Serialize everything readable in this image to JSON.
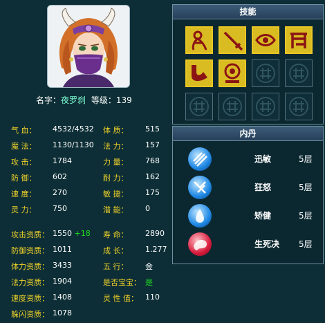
{
  "character": {
    "name_label": "名字：",
    "name": "夜罗刹",
    "level_label": "等级：",
    "level": "139"
  },
  "stats": [
    {
      "label": "气    血：",
      "value": "4532/4532"
    },
    {
      "label": "体    质：",
      "value": "515"
    },
    {
      "label": "魔    法：",
      "value": "1130/1130"
    },
    {
      "label": "法    力：",
      "value": "157"
    },
    {
      "label": "攻    击：",
      "value": "1784"
    },
    {
      "label": "力    量：",
      "value": "768"
    },
    {
      "label": "防    御：",
      "value": "602"
    },
    {
      "label": "耐    力：",
      "value": "162"
    },
    {
      "label": "速    度：",
      "value": "270"
    },
    {
      "label": "敏    捷：",
      "value": "175"
    },
    {
      "label": "灵    力：",
      "value": "750"
    },
    {
      "label": "潜    能：",
      "value": "0"
    }
  ],
  "aptitudes": [
    {
      "label": "攻击资质：",
      "value": "1550",
      "bonus": "+18"
    },
    {
      "label": "寿    命：",
      "value": "2890"
    },
    {
      "label": "防御资质：",
      "value": "1011"
    },
    {
      "label": "成    长：",
      "value": "1.277"
    },
    {
      "label": "体力资质：",
      "value": "3433"
    },
    {
      "label": "五    行：",
      "value": "金"
    },
    {
      "label": "法力资质：",
      "value": "1904"
    },
    {
      "label": "是否宝宝：",
      "value": "是"
    },
    {
      "label": "速度资质：",
      "value": "1408"
    },
    {
      "label": "灵 性 值：",
      "value": "110"
    },
    {
      "label": "躲闪资质：",
      "value": "1078"
    }
  ],
  "skills_panel": {
    "title": "技能",
    "skills": [
      {
        "icon": "figure-skill-icon"
      },
      {
        "icon": "sword-skill-icon"
      },
      {
        "icon": "eye-skill-icon"
      },
      {
        "icon": "gate-skill-icon"
      },
      {
        "icon": "claw-skill-icon"
      },
      {
        "icon": "seal-skill-icon"
      },
      {
        "icon": "empty-slot-icon"
      },
      {
        "icon": "empty-slot-icon"
      },
      {
        "icon": "empty-slot-icon"
      },
      {
        "icon": "empty-slot-icon"
      },
      {
        "icon": "empty-slot-icon"
      },
      {
        "icon": "empty-slot-icon"
      }
    ]
  },
  "neidan_panel": {
    "title": "内丹",
    "items": [
      {
        "name": "迅敏",
        "level": "5层",
        "icon": "swift-orb-icon",
        "color": "#1e88e5"
      },
      {
        "name": "狂怒",
        "level": "5层",
        "icon": "fury-orb-icon",
        "color": "#1e88e5"
      },
      {
        "name": "矫健",
        "level": "5层",
        "icon": "vigor-orb-icon",
        "color": "#1e88e5"
      },
      {
        "name": "生死决",
        "level": "5层",
        "icon": "lifedeath-orb-icon",
        "color": "#d81b3c"
      }
    ]
  },
  "colors": {
    "label_yellow": "#f0d22a",
    "name_cyan": "#7fffd4",
    "bonus_green": "#1fe01f",
    "background": "#0d2e36"
  }
}
